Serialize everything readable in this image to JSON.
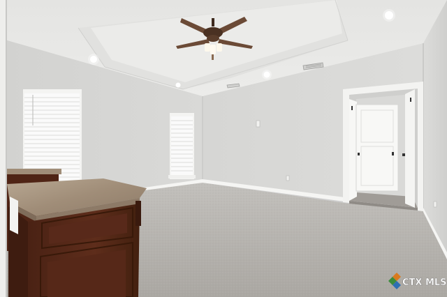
{
  "photo": {
    "colors": {
      "wall": "#d8d8d6",
      "ceiling": "#e9e9e7",
      "carpet": "#b9b6b1",
      "trim": "#f5f5f3",
      "cabinet": "#5a2b1a",
      "countertop": "#a89682",
      "fan": "#6b4a36"
    }
  },
  "watermark": {
    "brand": "CTX MLS",
    "colors": {
      "c": "#3c8c3c",
      "t": "#d97a1e",
      "x": "#2e6fb3",
      "mls": "#ffffff"
    }
  }
}
